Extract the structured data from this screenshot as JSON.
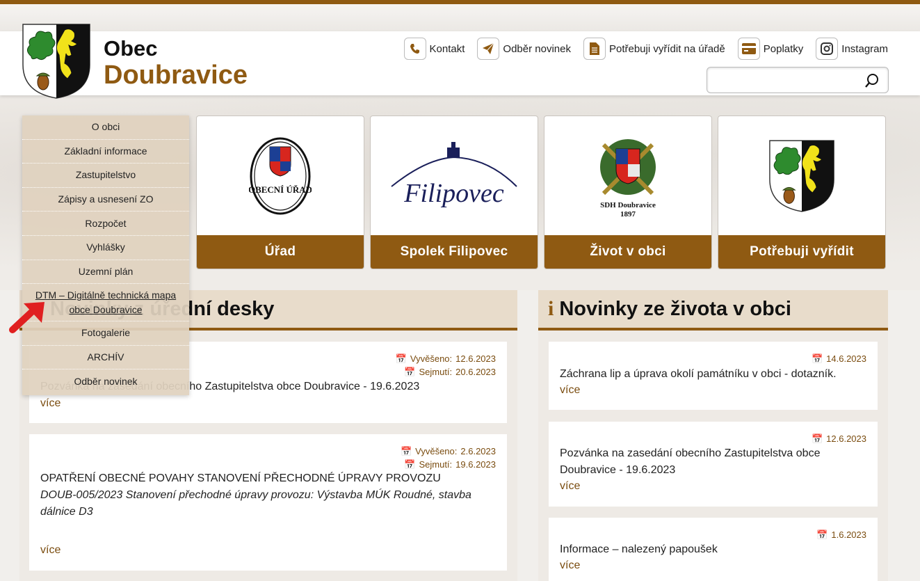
{
  "header": {
    "title_line1": "Obec",
    "title_line2": "Doubravice",
    "links": [
      {
        "label": "Kontakt",
        "icon": "phone-icon"
      },
      {
        "label": "Odběr novinek",
        "icon": "send-icon"
      },
      {
        "label": "Potřebuji vyřídit na úřadě",
        "icon": "document-icon"
      },
      {
        "label": "Poplatky",
        "icon": "credit-card-icon"
      },
      {
        "label": "Instagram",
        "icon": "instagram-icon"
      }
    ],
    "search": {
      "placeholder": ""
    }
  },
  "menu": {
    "items": [
      "O obci",
      "Základní informace",
      "Zastupitelstvo",
      "Zápisy a usnesení ZO",
      "Rozpočet",
      "Vyhlášky",
      "Uzemní plán",
      "DTM – Digitálně technická mapa obce Doubravice",
      "Fotogalerie",
      "ARCHÍV",
      "Odběr novinek"
    ]
  },
  "tiles": [
    {
      "label": "Úřad",
      "logo_text": "OBECNÍ ÚŘAD"
    },
    {
      "label": "Spolek Filipovec",
      "logo_text": "Filipovec"
    },
    {
      "label": "Život v obci",
      "logo_text": "SDH Doubravice",
      "logo_text2": "1897"
    },
    {
      "label": "Potřebuji vyřídit"
    }
  ],
  "board": {
    "title": "Novinky z úřední desky",
    "visible_title": "ední desky",
    "posts": [
      {
        "posted_label": "Vyvěšeno:",
        "posted": "12.6.2023",
        "removed_label": "Sejmutí:",
        "removed": "20.6.2023",
        "title": "Pozvánka na zasedání obecního Zastupitelstva obce Doubravice - 19.6.2023",
        "more": "více"
      },
      {
        "posted_label": "Vyvěšeno:",
        "posted": "2.6.2023",
        "removed_label": "Sejmutí:",
        "removed": "19.6.2023",
        "title": "OPATŘENÍ OBECNÉ POVAHY STANOVENÍ PŘECHODNÉ ÚPRAVY PROVOZU",
        "desc": "DOUB-005/2023 Stanovení přechodné úpravy provozu: Výstavba MÚK Roudné, stavba dálnice D3",
        "more": "více"
      }
    ]
  },
  "news": {
    "title": "Novinky ze života v obci",
    "icon": "info-icon",
    "posts": [
      {
        "date": "14.6.2023",
        "title": "Záchrana lip a úprava okolí památníku v obci - dotazník.",
        "more": "více"
      },
      {
        "date": "12.6.2023",
        "title": "Pozvánka na zasedání obecního Zastupitelstva obce Doubravice - 19.6.2023",
        "more": "více"
      },
      {
        "date": "1.6.2023",
        "title": "Informace – nalezený papoušek",
        "more": "více"
      }
    ]
  },
  "colors": {
    "brand": "#8f5a12",
    "panel_bg": "#e8dccb",
    "arrow": "#e02020"
  }
}
